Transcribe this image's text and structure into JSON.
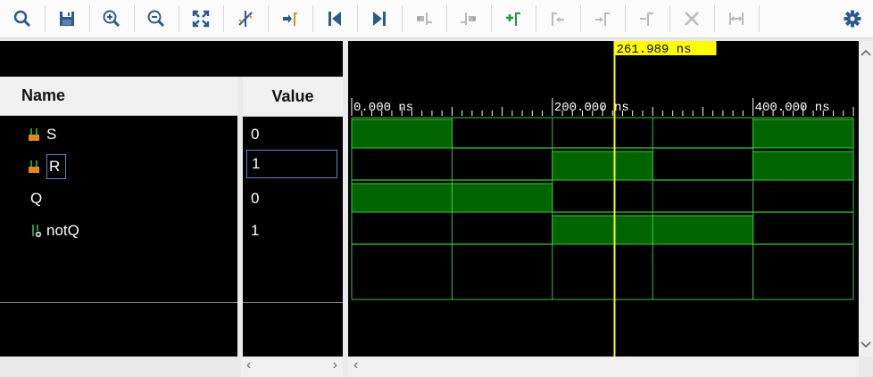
{
  "toolbar": {
    "buttons": [
      {
        "name": "search-button",
        "icon": "search-icon"
      },
      {
        "name": "save-button",
        "icon": "save-icon"
      },
      {
        "name": "zoom-in-button",
        "icon": "zoom-in-icon"
      },
      {
        "name": "zoom-out-button",
        "icon": "zoom-out-icon"
      },
      {
        "name": "zoom-fit-button",
        "icon": "zoom-fit-icon"
      },
      {
        "name": "zoom-to-cursor-button",
        "icon": "zoom-cursor-icon"
      },
      {
        "name": "go-to-time-zero-button",
        "icon": "go-to-zero-icon"
      },
      {
        "name": "go-to-beginning-button",
        "icon": "go-to-beginning-icon"
      },
      {
        "name": "go-to-end-button",
        "icon": "go-to-end-icon"
      },
      {
        "name": "previous-transition-button",
        "icon": "previous-transition-icon"
      },
      {
        "name": "next-transition-button",
        "icon": "next-transition-icon"
      },
      {
        "name": "add-marker-button",
        "icon": "add-marker-icon"
      },
      {
        "name": "previous-marker-button",
        "icon": "previous-marker-icon"
      },
      {
        "name": "next-marker-button",
        "icon": "next-marker-icon"
      },
      {
        "name": "swap-cursors-button",
        "icon": "swap-cursors-icon"
      },
      {
        "name": "remove-marker-button",
        "icon": "close-icon"
      },
      {
        "name": "snap-button",
        "icon": "snap-icon"
      },
      {
        "name": "settings-button",
        "icon": "gear-icon"
      }
    ]
  },
  "columns": {
    "name_header": "Name",
    "value_header": "Value"
  },
  "signals": [
    {
      "name": "S",
      "value": "0",
      "icon": "input-port-icon",
      "waveform": [
        1,
        0,
        0,
        0,
        1
      ]
    },
    {
      "name": "R",
      "value": "1",
      "icon": "input-port-icon",
      "waveform": [
        0,
        0,
        1,
        0,
        1
      ]
    },
    {
      "name": "Q",
      "value": "0",
      "icon": "",
      "waveform": [
        1,
        1,
        0,
        0,
        0
      ]
    },
    {
      "name": "notQ",
      "value": "1",
      "icon": "output-port-icon",
      "waveform": [
        0,
        0,
        1,
        1,
        0
      ]
    }
  ],
  "timeline": {
    "cursor_label": "261.989 ns",
    "cursor_time_ns": 261.989,
    "tick_labels": [
      "0.000 ns",
      "200.000 ns",
      "400.000 ns"
    ],
    "tick_times_ns": [
      0,
      200,
      400
    ],
    "segment_ns": 100,
    "visible_range_ns": [
      0,
      500
    ]
  },
  "colors": {
    "waveform_fill": "#006400",
    "waveform_line": "#33cc33",
    "cursor": "#ffff00",
    "icon_blue": "#2c5a8e",
    "icon_green": "#1e9c3a",
    "port_icon_orange": "#e08a1e"
  }
}
